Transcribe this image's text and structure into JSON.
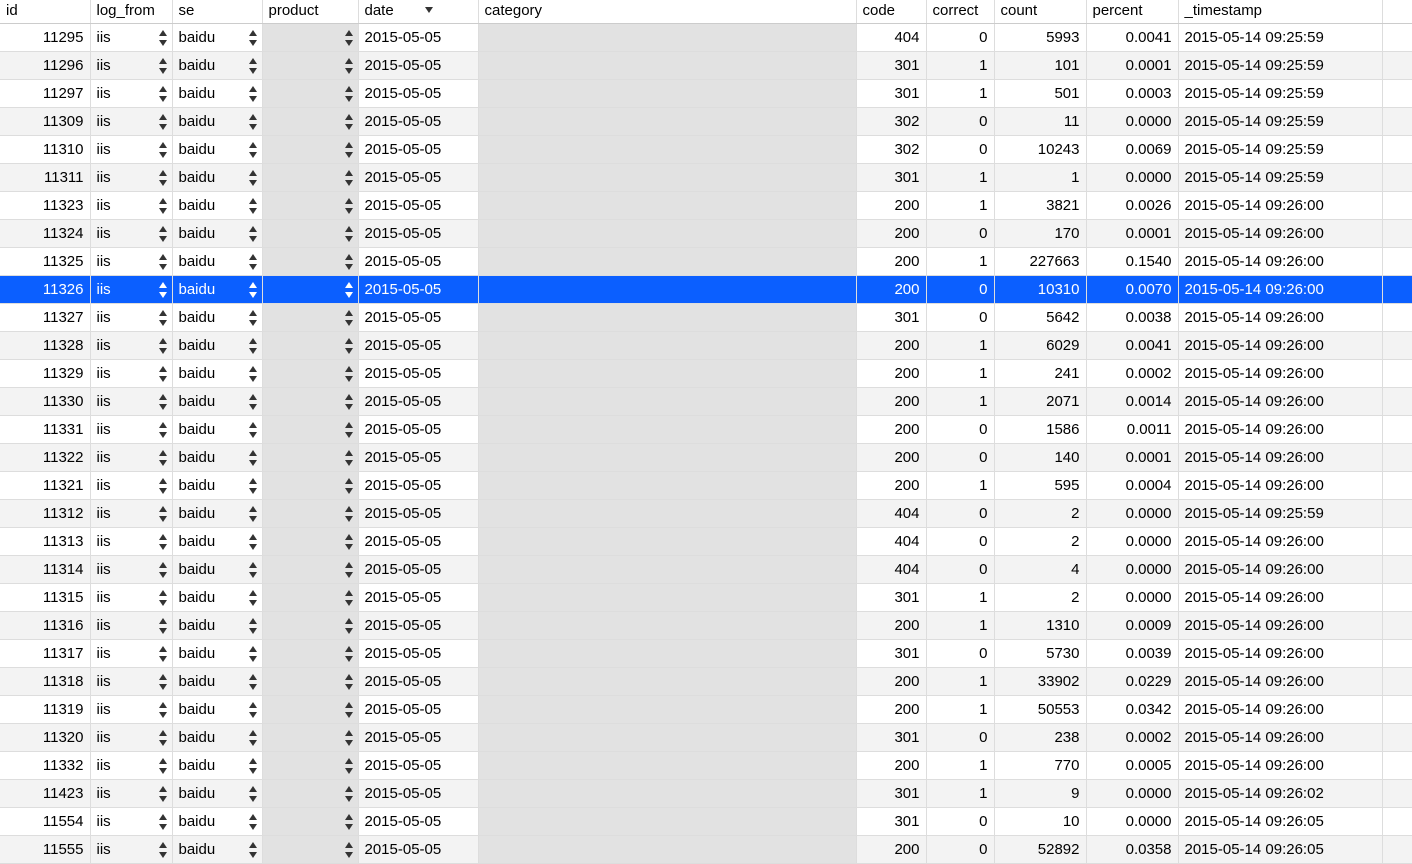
{
  "columns": [
    {
      "key": "id",
      "label": "id",
      "width": "col-id",
      "align": "num"
    },
    {
      "key": "log_from",
      "label": "log_from",
      "width": "col-log_from",
      "stepper": true
    },
    {
      "key": "se",
      "label": "se",
      "width": "col-se",
      "stepper": true
    },
    {
      "key": "product",
      "label": "product",
      "width": "col-product",
      "stepper": true,
      "blank": true
    },
    {
      "key": "date",
      "label": "date",
      "width": "col-date",
      "sortCaret": true
    },
    {
      "key": "category",
      "label": "category",
      "width": "col-category",
      "blank": true
    },
    {
      "key": "code",
      "label": "code",
      "width": "col-code",
      "align": "num"
    },
    {
      "key": "correct",
      "label": "correct",
      "width": "col-correct",
      "align": "num"
    },
    {
      "key": "count",
      "label": "count",
      "width": "col-count",
      "align": "num"
    },
    {
      "key": "percent",
      "label": "percent",
      "width": "col-percent",
      "align": "num"
    },
    {
      "key": "timestamp",
      "label": "_timestamp",
      "width": "col-timestamp"
    },
    {
      "key": "_spacer",
      "label": "",
      "width": "col-spacer"
    }
  ],
  "selectedId": 11326,
  "rows": [
    {
      "id": 11295,
      "log_from": "iis",
      "se": "baidu",
      "product": "",
      "date": "2015-05-05",
      "category": "",
      "code": 404,
      "correct": 0,
      "count": 5993,
      "percent": "0.0041",
      "timestamp": "2015-05-14 09:25:59"
    },
    {
      "id": 11296,
      "log_from": "iis",
      "se": "baidu",
      "product": "",
      "date": "2015-05-05",
      "category": "",
      "code": 301,
      "correct": 1,
      "count": 101,
      "percent": "0.0001",
      "timestamp": "2015-05-14 09:25:59"
    },
    {
      "id": 11297,
      "log_from": "iis",
      "se": "baidu",
      "product": "",
      "date": "2015-05-05",
      "category": "",
      "code": 301,
      "correct": 1,
      "count": 501,
      "percent": "0.0003",
      "timestamp": "2015-05-14 09:25:59"
    },
    {
      "id": 11309,
      "log_from": "iis",
      "se": "baidu",
      "product": "",
      "date": "2015-05-05",
      "category": "",
      "code": 302,
      "correct": 0,
      "count": 11,
      "percent": "0.0000",
      "timestamp": "2015-05-14 09:25:59"
    },
    {
      "id": 11310,
      "log_from": "iis",
      "se": "baidu",
      "product": "",
      "date": "2015-05-05",
      "category": "",
      "code": 302,
      "correct": 0,
      "count": 10243,
      "percent": "0.0069",
      "timestamp": "2015-05-14 09:25:59"
    },
    {
      "id": 11311,
      "log_from": "iis",
      "se": "baidu",
      "product": "",
      "date": "2015-05-05",
      "category": "",
      "code": 301,
      "correct": 1,
      "count": 1,
      "percent": "0.0000",
      "timestamp": "2015-05-14 09:25:59"
    },
    {
      "id": 11323,
      "log_from": "iis",
      "se": "baidu",
      "product": "",
      "date": "2015-05-05",
      "category": "",
      "code": 200,
      "correct": 1,
      "count": 3821,
      "percent": "0.0026",
      "timestamp": "2015-05-14 09:26:00"
    },
    {
      "id": 11324,
      "log_from": "iis",
      "se": "baidu",
      "product": "",
      "date": "2015-05-05",
      "category": "",
      "code": 200,
      "correct": 0,
      "count": 170,
      "percent": "0.0001",
      "timestamp": "2015-05-14 09:26:00"
    },
    {
      "id": 11325,
      "log_from": "iis",
      "se": "baidu",
      "product": "",
      "date": "2015-05-05",
      "category": "",
      "code": 200,
      "correct": 1,
      "count": 227663,
      "percent": "0.1540",
      "timestamp": "2015-05-14 09:26:00"
    },
    {
      "id": 11326,
      "log_from": "iis",
      "se": "baidu",
      "product": "",
      "date": "2015-05-05",
      "category": "",
      "code": 200,
      "correct": 0,
      "count": 10310,
      "percent": "0.0070",
      "timestamp": "2015-05-14 09:26:00"
    },
    {
      "id": 11327,
      "log_from": "iis",
      "se": "baidu",
      "product": "",
      "date": "2015-05-05",
      "category": "",
      "code": 301,
      "correct": 0,
      "count": 5642,
      "percent": "0.0038",
      "timestamp": "2015-05-14 09:26:00"
    },
    {
      "id": 11328,
      "log_from": "iis",
      "se": "baidu",
      "product": "",
      "date": "2015-05-05",
      "category": "",
      "code": 200,
      "correct": 1,
      "count": 6029,
      "percent": "0.0041",
      "timestamp": "2015-05-14 09:26:00"
    },
    {
      "id": 11329,
      "log_from": "iis",
      "se": "baidu",
      "product": "",
      "date": "2015-05-05",
      "category": "",
      "code": 200,
      "correct": 1,
      "count": 241,
      "percent": "0.0002",
      "timestamp": "2015-05-14 09:26:00"
    },
    {
      "id": 11330,
      "log_from": "iis",
      "se": "baidu",
      "product": "",
      "date": "2015-05-05",
      "category": "",
      "code": 200,
      "correct": 1,
      "count": 2071,
      "percent": "0.0014",
      "timestamp": "2015-05-14 09:26:00"
    },
    {
      "id": 11331,
      "log_from": "iis",
      "se": "baidu",
      "product": "",
      "date": "2015-05-05",
      "category": "",
      "code": 200,
      "correct": 0,
      "count": 1586,
      "percent": "0.0011",
      "timestamp": "2015-05-14 09:26:00"
    },
    {
      "id": 11322,
      "log_from": "iis",
      "se": "baidu",
      "product": "",
      "date": "2015-05-05",
      "category": "",
      "code": 200,
      "correct": 0,
      "count": 140,
      "percent": "0.0001",
      "timestamp": "2015-05-14 09:26:00"
    },
    {
      "id": 11321,
      "log_from": "iis",
      "se": "baidu",
      "product": "",
      "date": "2015-05-05",
      "category": "",
      "code": 200,
      "correct": 1,
      "count": 595,
      "percent": "0.0004",
      "timestamp": "2015-05-14 09:26:00"
    },
    {
      "id": 11312,
      "log_from": "iis",
      "se": "baidu",
      "product": "",
      "date": "2015-05-05",
      "category": "",
      "code": 404,
      "correct": 0,
      "count": 2,
      "percent": "0.0000",
      "timestamp": "2015-05-14 09:25:59"
    },
    {
      "id": 11313,
      "log_from": "iis",
      "se": "baidu",
      "product": "",
      "date": "2015-05-05",
      "category": "",
      "code": 404,
      "correct": 0,
      "count": 2,
      "percent": "0.0000",
      "timestamp": "2015-05-14 09:26:00"
    },
    {
      "id": 11314,
      "log_from": "iis",
      "se": "baidu",
      "product": "",
      "date": "2015-05-05",
      "category": "",
      "code": 404,
      "correct": 0,
      "count": 4,
      "percent": "0.0000",
      "timestamp": "2015-05-14 09:26:00"
    },
    {
      "id": 11315,
      "log_from": "iis",
      "se": "baidu",
      "product": "",
      "date": "2015-05-05",
      "category": "",
      "code": 301,
      "correct": 1,
      "count": 2,
      "percent": "0.0000",
      "timestamp": "2015-05-14 09:26:00"
    },
    {
      "id": 11316,
      "log_from": "iis",
      "se": "baidu",
      "product": "",
      "date": "2015-05-05",
      "category": "",
      "code": 200,
      "correct": 1,
      "count": 1310,
      "percent": "0.0009",
      "timestamp": "2015-05-14 09:26:00"
    },
    {
      "id": 11317,
      "log_from": "iis",
      "se": "baidu",
      "product": "",
      "date": "2015-05-05",
      "category": "",
      "code": 301,
      "correct": 0,
      "count": 5730,
      "percent": "0.0039",
      "timestamp": "2015-05-14 09:26:00"
    },
    {
      "id": 11318,
      "log_from": "iis",
      "se": "baidu",
      "product": "",
      "date": "2015-05-05",
      "category": "",
      "code": 200,
      "correct": 1,
      "count": 33902,
      "percent": "0.0229",
      "timestamp": "2015-05-14 09:26:00"
    },
    {
      "id": 11319,
      "log_from": "iis",
      "se": "baidu",
      "product": "",
      "date": "2015-05-05",
      "category": "",
      "code": 200,
      "correct": 1,
      "count": 50553,
      "percent": "0.0342",
      "timestamp": "2015-05-14 09:26:00"
    },
    {
      "id": 11320,
      "log_from": "iis",
      "se": "baidu",
      "product": "",
      "date": "2015-05-05",
      "category": "",
      "code": 301,
      "correct": 0,
      "count": 238,
      "percent": "0.0002",
      "timestamp": "2015-05-14 09:26:00"
    },
    {
      "id": 11332,
      "log_from": "iis",
      "se": "baidu",
      "product": "",
      "date": "2015-05-05",
      "category": "",
      "code": 200,
      "correct": 1,
      "count": 770,
      "percent": "0.0005",
      "timestamp": "2015-05-14 09:26:00"
    },
    {
      "id": 11423,
      "log_from": "iis",
      "se": "baidu",
      "product": "",
      "date": "2015-05-05",
      "category": "",
      "code": 301,
      "correct": 1,
      "count": 9,
      "percent": "0.0000",
      "timestamp": "2015-05-14 09:26:02"
    },
    {
      "id": 11554,
      "log_from": "iis",
      "se": "baidu",
      "product": "",
      "date": "2015-05-05",
      "category": "",
      "code": 301,
      "correct": 0,
      "count": 10,
      "percent": "0.0000",
      "timestamp": "2015-05-14 09:26:05"
    },
    {
      "id": 11555,
      "log_from": "iis",
      "se": "baidu",
      "product": "",
      "date": "2015-05-05",
      "category": "",
      "code": 200,
      "correct": 0,
      "count": 52892,
      "percent": "0.0358",
      "timestamp": "2015-05-14 09:26:05"
    }
  ]
}
